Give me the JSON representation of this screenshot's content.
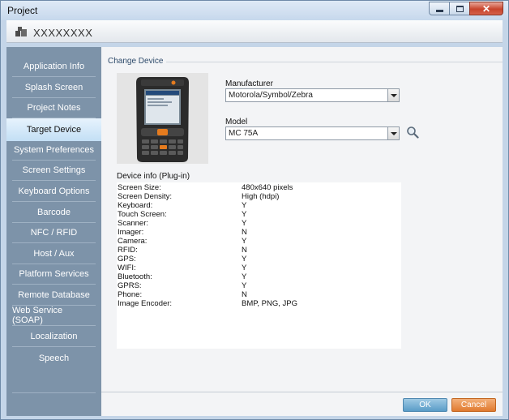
{
  "window": {
    "title": "Project",
    "buttons": {
      "minimize": "minimize-icon",
      "maximize": "maximize-icon",
      "close": "close-icon"
    }
  },
  "project": {
    "name": "XXXXXXXX",
    "icon": "project-icon"
  },
  "sidebar": {
    "items": [
      {
        "label": "Application Info",
        "active": false
      },
      {
        "label": "Splash Screen",
        "active": false
      },
      {
        "label": "Project Notes",
        "active": false
      },
      {
        "label": "Target Device",
        "active": true
      },
      {
        "label": "System Preferences",
        "active": false
      },
      {
        "label": "Screen Settings",
        "active": false
      },
      {
        "label": "Keyboard Options",
        "active": false
      },
      {
        "label": "Barcode",
        "active": false
      },
      {
        "label": "NFC / RFID",
        "active": false
      },
      {
        "label": "Host / Aux",
        "active": false
      },
      {
        "label": "Platform Services",
        "active": false
      },
      {
        "label": "Remote Database",
        "active": false
      },
      {
        "label": "Web Service (SOAP)",
        "active": false
      },
      {
        "label": "Localization",
        "active": false
      },
      {
        "label": "Speech",
        "active": false
      }
    ]
  },
  "main": {
    "group_title": "Change Device",
    "manufacturer": {
      "label": "Manufacturer",
      "value": "Motorola/Symbol/Zebra"
    },
    "model": {
      "label": "Model",
      "value": "MC 75A",
      "search_icon": "magnifier-icon"
    },
    "device_info": {
      "title": "Device info (Plug-in)",
      "rows": [
        {
          "key": "Screen Size:",
          "value": "480x640 pixels"
        },
        {
          "key": "Screen Density:",
          "value": "High (hdpi)"
        },
        {
          "key": "Keyboard:",
          "value": "Y"
        },
        {
          "key": "Touch Screen:",
          "value": "Y"
        },
        {
          "key": "Scanner:",
          "value": "Y"
        },
        {
          "key": "Imager:",
          "value": "N"
        },
        {
          "key": "Camera:",
          "value": "Y"
        },
        {
          "key": "RFID:",
          "value": "N"
        },
        {
          "key": "GPS:",
          "value": "Y"
        },
        {
          "key": "WIFI:",
          "value": "Y"
        },
        {
          "key": "Bluetooth:",
          "value": "Y"
        },
        {
          "key": "GPRS:",
          "value": "Y"
        },
        {
          "key": "Phone:",
          "value": "N"
        },
        {
          "key": "Image Encoder:",
          "value": "BMP, PNG, JPG"
        }
      ]
    }
  },
  "footer": {
    "ok_label": "OK",
    "cancel_label": "Cancel"
  },
  "colors": {
    "ok": "#5a9cc7",
    "cancel": "#e07a30",
    "sidebar": "#7d93a9",
    "active_item": "#c3dff5"
  }
}
